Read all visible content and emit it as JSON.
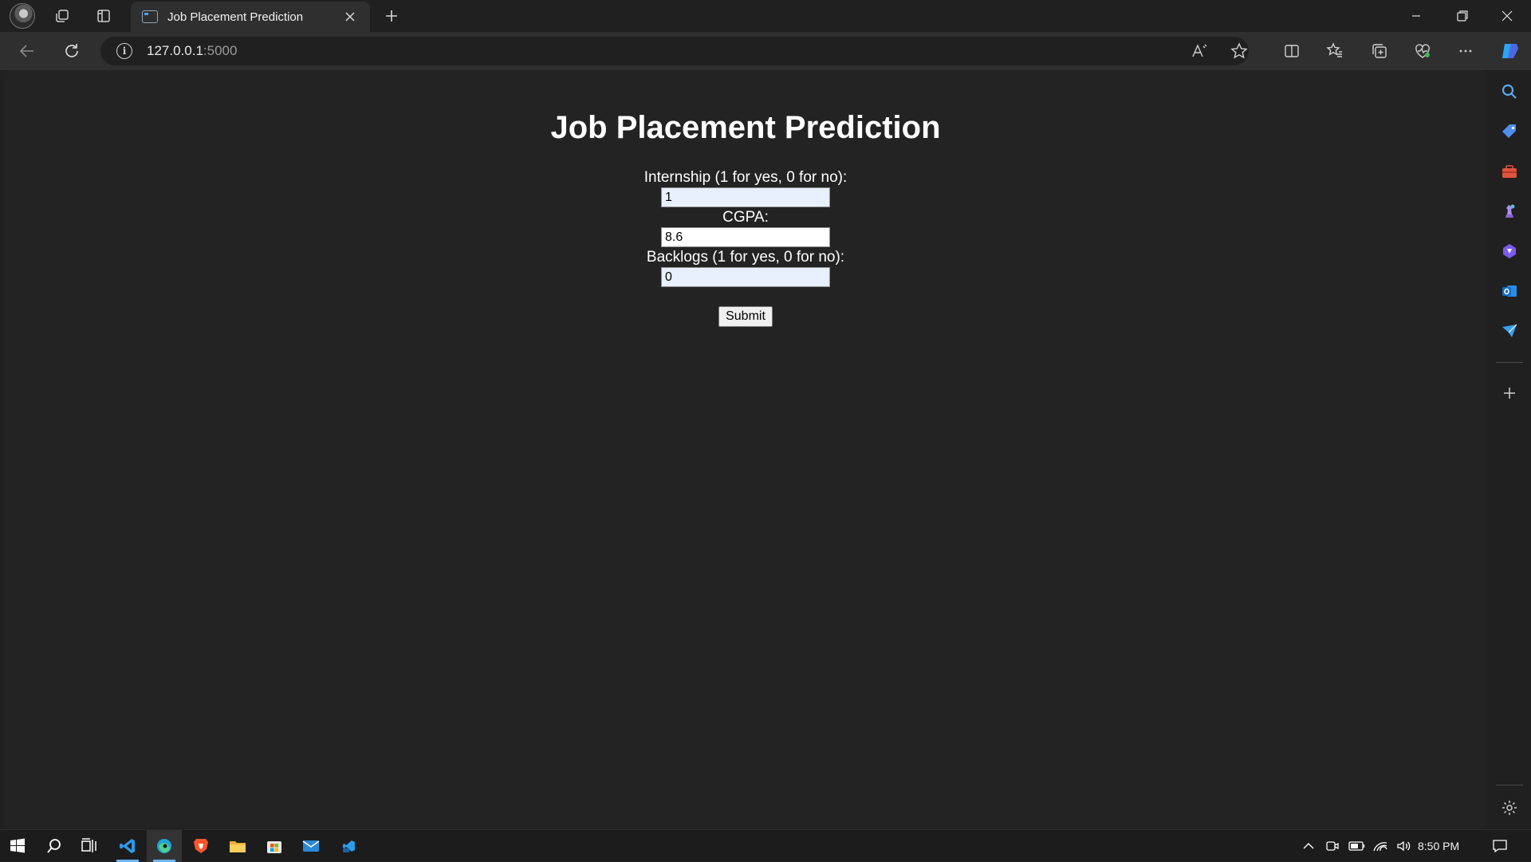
{
  "browser": {
    "tab": {
      "title": "Job Placement Prediction"
    },
    "address": {
      "host": "127.0.0.1",
      "port": ":5000"
    }
  },
  "page": {
    "heading": "Job Placement Prediction",
    "fields": [
      {
        "label": "Internship (1 for yes, 0 for no):",
        "value": "1"
      },
      {
        "label": "CGPA:",
        "value": "8.6"
      },
      {
        "label": "Backlogs (1 for yes, 0 for no):",
        "value": "0"
      }
    ],
    "submit_label": "Submit"
  },
  "sidebar": {
    "icons": [
      "search-icon",
      "tag-icon",
      "toolbox-icon",
      "chess-icon",
      "copilot-icon",
      "outlook-icon",
      "send-icon",
      "add-icon",
      "settings-icon"
    ]
  },
  "taskbar": {
    "apps": [
      "windows-start-icon",
      "search-icon",
      "task-view-icon",
      "vscode-icon",
      "edge-icon",
      "brave-icon",
      "file-explorer-icon",
      "store-icon",
      "mail-icon",
      "terminal-icon"
    ],
    "time": "8:50 PM"
  },
  "colors": {
    "page_bg": "#232323",
    "chrome_bg": "#202020",
    "toolbar_bg": "#2f2f2f",
    "autofill_bg": "#e8f0fe"
  }
}
